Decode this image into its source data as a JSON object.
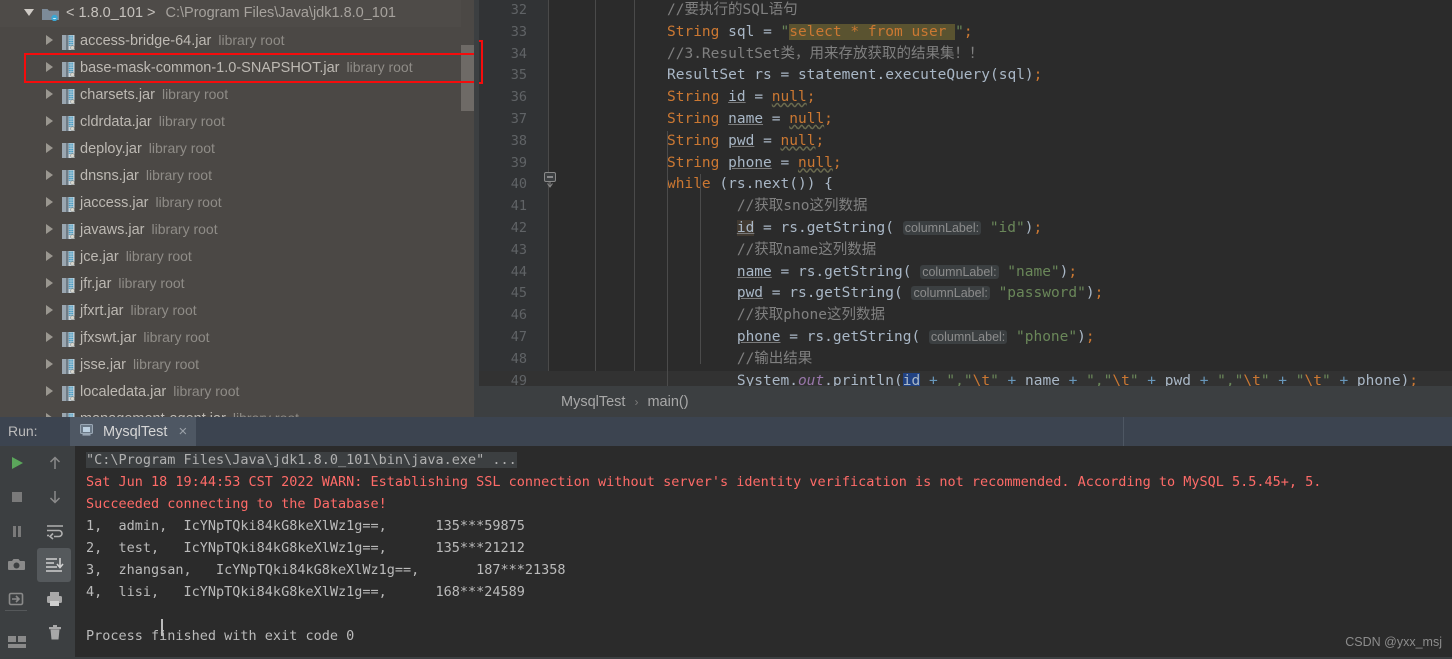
{
  "tree": {
    "root": {
      "label": "< 1.8.0_101 >",
      "path": "C:\\Program Files\\Java\\jdk1.8.0_101",
      "icon": "folder-icon",
      "expanded": true
    },
    "tag": "library root",
    "items": [
      {
        "name": "access-bridge-64.jar",
        "tag": "library root"
      },
      {
        "name": "base-mask-common-1.0-SNAPSHOT.jar",
        "tag": "library root"
      },
      {
        "name": "charsets.jar",
        "tag": "library root"
      },
      {
        "name": "cldrdata.jar",
        "tag": "library root"
      },
      {
        "name": "deploy.jar",
        "tag": "library root"
      },
      {
        "name": "dnsns.jar",
        "tag": "library root"
      },
      {
        "name": "jaccess.jar",
        "tag": "library root"
      },
      {
        "name": "javaws.jar",
        "tag": "library root"
      },
      {
        "name": "jce.jar",
        "tag": "library root"
      },
      {
        "name": "jfr.jar",
        "tag": "library root"
      },
      {
        "name": "jfxrt.jar",
        "tag": "library root"
      },
      {
        "name": "jfxswt.jar",
        "tag": "library root"
      },
      {
        "name": "jsse.jar",
        "tag": "library root"
      },
      {
        "name": "localedata.jar",
        "tag": "library root"
      },
      {
        "name": "management-agent.jar",
        "tag": "library root"
      }
    ],
    "highlight_index": 1,
    "highlight_color": "#f50c0c"
  },
  "editor": {
    "first_line_number": 32,
    "lines": [
      {
        "n": "32",
        "text": "//要执行的SQL语句"
      },
      {
        "n": "33",
        "text": "String sql = \"select * from user \";"
      },
      {
        "n": "34",
        "text": "//3.ResultSet类，用来存放获取的结果集！！"
      },
      {
        "n": "35",
        "text": "ResultSet rs = statement.executeQuery(sql);"
      },
      {
        "n": "36",
        "text": "String id = null;"
      },
      {
        "n": "37",
        "text": "String name = null;"
      },
      {
        "n": "38",
        "text": "String pwd = null;"
      },
      {
        "n": "39",
        "text": "String phone = null;"
      },
      {
        "n": "40",
        "text": "while (rs.next()) {"
      },
      {
        "n": "41",
        "text": "//获取sno这列数据"
      },
      {
        "n": "42",
        "text": "id = rs.getString( columnLabel: \"id\");"
      },
      {
        "n": "43",
        "text": "//获取name这列数据"
      },
      {
        "n": "44",
        "text": "name = rs.getString( columnLabel: \"name\");"
      },
      {
        "n": "45",
        "text": "pwd = rs.getString( columnLabel: \"password\");"
      },
      {
        "n": "46",
        "text": "//获取phone这列数据"
      },
      {
        "n": "47",
        "text": "phone = rs.getString( columnLabel: \"phone\");"
      },
      {
        "n": "48",
        "text": "//输出结果"
      },
      {
        "n": "49",
        "text": "System.out.println(id + \",\\t\" + name + \",\\t\" + pwd + \",\\t\" + \"\\t\" + phone);"
      }
    ],
    "sql_literal": "select * from user ",
    "hint_label": "columnLabel:",
    "current_line": "49"
  },
  "breadcrumb": {
    "class_name": "MysqlTest",
    "separator": "›",
    "method_name": "main()"
  },
  "run_window": {
    "label": "Run:",
    "tab": {
      "name": "MysqlTest",
      "icon": "run-config-icon",
      "close": "×"
    },
    "toolbar_left": [
      {
        "icon": "run-icon",
        "name": "rerun-button"
      },
      {
        "icon": "stop-icon",
        "name": "stop-button"
      },
      {
        "icon": "pause-icon",
        "name": "pause-button"
      },
      {
        "icon": "camera-icon",
        "name": "dump-threads-button"
      },
      {
        "icon": "export-icon",
        "name": "export-button"
      },
      {
        "icon": "layout-icon",
        "name": "layout-button"
      }
    ],
    "toolbar_mid": [
      {
        "icon": "arrow-up-icon",
        "name": "prev-occurrence-button",
        "active": false
      },
      {
        "icon": "arrow-down-icon",
        "name": "next-occurrence-button",
        "active": false
      },
      {
        "icon": "soft-wrap-icon",
        "name": "soft-wrap-button",
        "active": false
      },
      {
        "icon": "scroll-to-end-icon",
        "name": "scroll-to-end-button",
        "active": true
      },
      {
        "icon": "print-icon",
        "name": "print-button",
        "active": false
      },
      {
        "icon": "trash-icon",
        "name": "clear-all-button",
        "active": false
      }
    ],
    "console": {
      "command": "\"C:\\Program Files\\Java\\jdk1.8.0_101\\bin\\java.exe\" ...",
      "warning": "Sat Jun 18 19:44:53 CST 2022 WARN: Establishing SSL connection without server's identity verification is not recommended. According to MySQL 5.5.45+, 5.",
      "success": "Succeeded connecting to the Database!",
      "rows": [
        "1,  admin,  IcYNpTQki84kG8keXlWz1g==,      135***59875",
        "2,  test,   IcYNpTQki84kG8keXlWz1g==,      135***21212",
        "3,  zhangsan,   IcYNpTQki84kG8keXlWz1g==,       187***21358",
        "4,  lisi,   IcYNpTQki84kG8keXlWz1g==,      168***24589"
      ],
      "blank": "",
      "exit": "Process finished with exit code 0"
    }
  },
  "watermark": "CSDN @yxx_msj",
  "colors": {
    "editor_bg": "#2b2b2b",
    "tree_bg": "#4b4845",
    "panel_bg": "#3c3f41",
    "keyword": "#cc7832",
    "string": "#6a8759",
    "comment": "#808080",
    "error_red": "#ff6b68",
    "highlight_red": "#f50c0c",
    "run_header_bg": "#3c4450"
  }
}
